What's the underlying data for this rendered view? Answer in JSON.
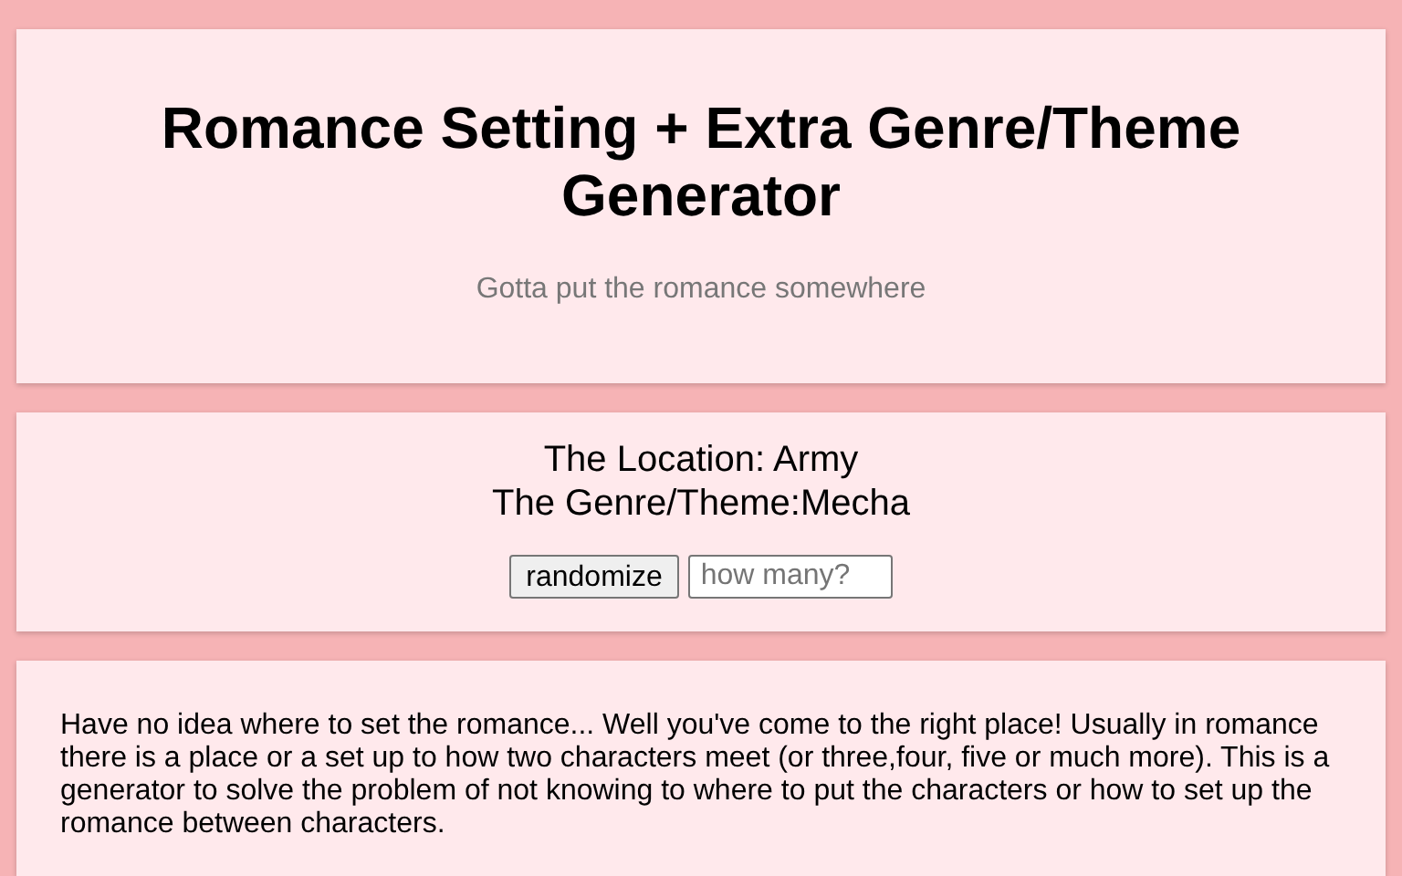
{
  "header": {
    "title": "Romance Setting + Extra Genre/Theme Generator",
    "subtitle": "Gotta put the romance somewhere"
  },
  "result": {
    "lines": [
      "The Location: Army",
      "The Genre/Theme:Mecha"
    ],
    "button": "randomize",
    "count_field": {
      "placeholder": "how many?"
    }
  },
  "description": "Have no idea where to set the romance... Well you've come to the right place! Usually in romance there is a place or a set up to how two characters meet (or three,four, five or much more). This is a generator to solve the problem of not knowing to where to put the characters or how to set up the romance between characters."
}
